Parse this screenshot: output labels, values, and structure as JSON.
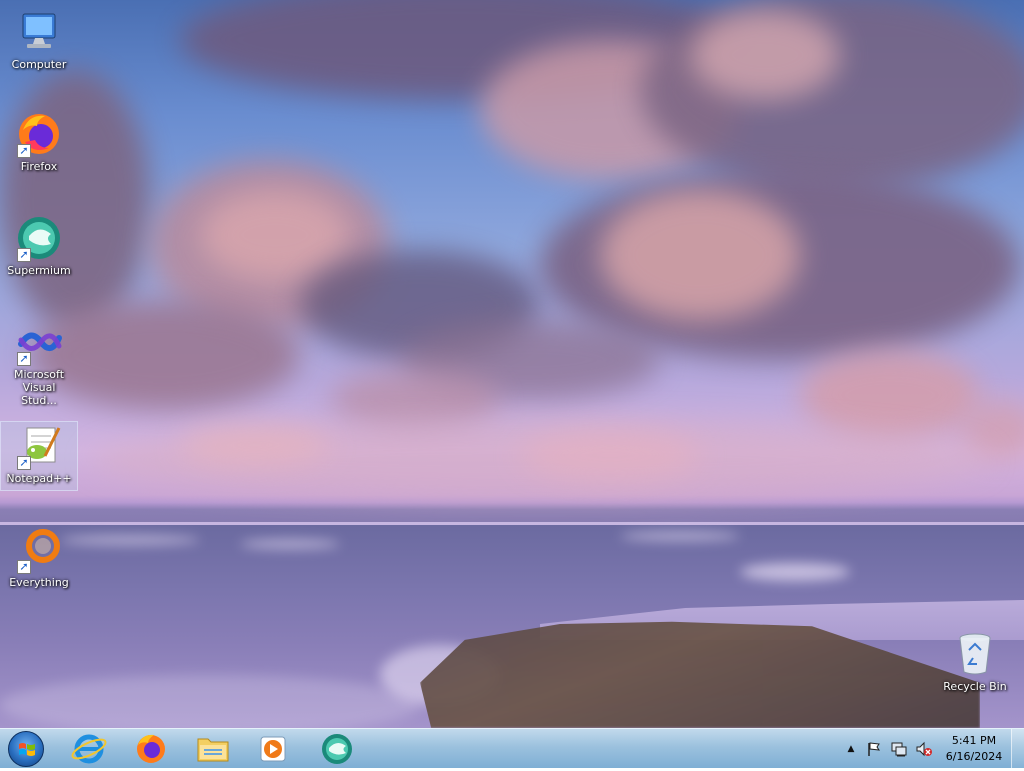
{
  "desktop": {
    "icons": [
      {
        "label": "Computer"
      },
      {
        "label": "Firefox"
      },
      {
        "label": "Supermium"
      },
      {
        "label": "Microsoft Visual Stud..."
      },
      {
        "label": "Notepad++"
      },
      {
        "label": "Everything"
      },
      {
        "label": "Recycle Bin"
      }
    ]
  },
  "taskbar": {
    "pinned": [
      {
        "icon": "internet-explorer-icon"
      },
      {
        "icon": "firefox-icon"
      },
      {
        "icon": "file-explorer-icon"
      },
      {
        "icon": "media-player-icon"
      },
      {
        "icon": "supermium-icon"
      }
    ],
    "tray": {
      "time": "5:41 PM",
      "date": "6/16/2024"
    }
  }
}
